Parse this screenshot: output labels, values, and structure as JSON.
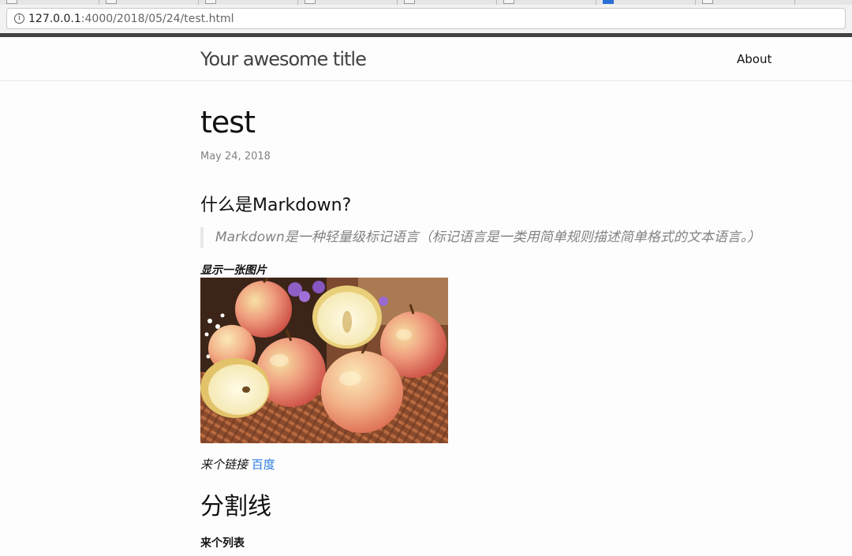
{
  "browser": {
    "address_host": "127.0.0.1",
    "address_path": ":4000/2018/05/24/test.html",
    "info_icon": "info-icon"
  },
  "site": {
    "title": "Your awesome title",
    "nav": [
      {
        "label": "About"
      }
    ]
  },
  "post": {
    "title": "test",
    "date": "May 24, 2018",
    "heading_markdown": "什么是Markdown?",
    "quote": "Markdown是一种轻量级标记语言（标记语言是一类用简单规则描述简单格式的文本语言。）",
    "image_caption": "显示一张图片",
    "link_prefix": "来个链接 ",
    "link_text": "百度",
    "divider_heading": "分割线",
    "list_heading": "来个列表"
  },
  "colors": {
    "link": "#2a7ae2",
    "top_bar": "#424242",
    "meta": "#828282"
  }
}
